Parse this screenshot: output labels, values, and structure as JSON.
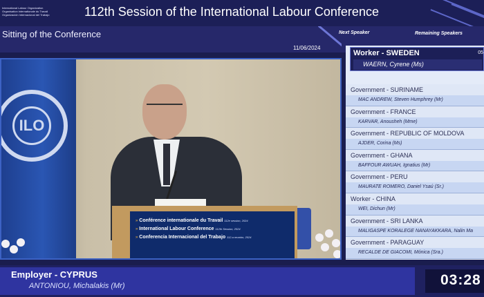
{
  "header": {
    "org_lines": [
      "International Labour Organization",
      "Organisation internationale du Travail",
      "Organización Internacional del Trabajo"
    ],
    "session_title": "112th Session of the International Labour Conference"
  },
  "subheader": {
    "sitting_title": "Sitting of the Conference",
    "date": "11/06/2024",
    "next_speaker_label": "Next Speaker",
    "remaining_speakers_label": "Remaining Speakers"
  },
  "podium": {
    "lines": [
      {
        "text": "Conférence internationale du Travail",
        "small": "112e session, 2024"
      },
      {
        "text": "International Labour Conference",
        "small": "112th Session, 2024"
      },
      {
        "text": "Conferencia Internacional del Trabajo",
        "small": "112.a reunión, 2024"
      }
    ]
  },
  "next_speaker": {
    "group": "Worker - SWEDEN",
    "clock": "05",
    "name": "WAERN, Cyrene (Ms)"
  },
  "remaining_speakers": [
    {
      "group": "Government - SURINAME",
      "name": "MAC ANDREW, Steven Humphrey (Mr)"
    },
    {
      "group": "Government - FRANCE",
      "name": "KARVAR, Anousheh (Mme)"
    },
    {
      "group": "Government - REPUBLIC OF MOLDOVA",
      "name": "AJDER, Corina (Ms)"
    },
    {
      "group": "Government - GHANA",
      "name": "BAFFOUR AWUAH, Ignatius (Mr)"
    },
    {
      "group": "Government - PERU",
      "name": "MAURATE ROMERO, Daniel Ysaú (Sr.)"
    },
    {
      "group": "Worker - CHINA",
      "name": "WEI, Dichun (Mr)"
    },
    {
      "group": "Government - SRI LANKA",
      "name": "MALIGASPE KORALEGE NANAYAKKARA, Nalin Ma"
    },
    {
      "group": "Government - PARAGUAY",
      "name": "RECALDE DE GIACOMI, Mónica (Sra.)"
    }
  ],
  "current_speaker": {
    "group": "Employer - CYPRUS",
    "name": "ANTONIOU, Michalakis (Mr)"
  },
  "timer": "03:28",
  "emblem_text": "ILO",
  "colors": {
    "header_bg": "#1c1f57",
    "accent_blue": "#2f34a0",
    "list_bg": "#dfe7f6"
  }
}
